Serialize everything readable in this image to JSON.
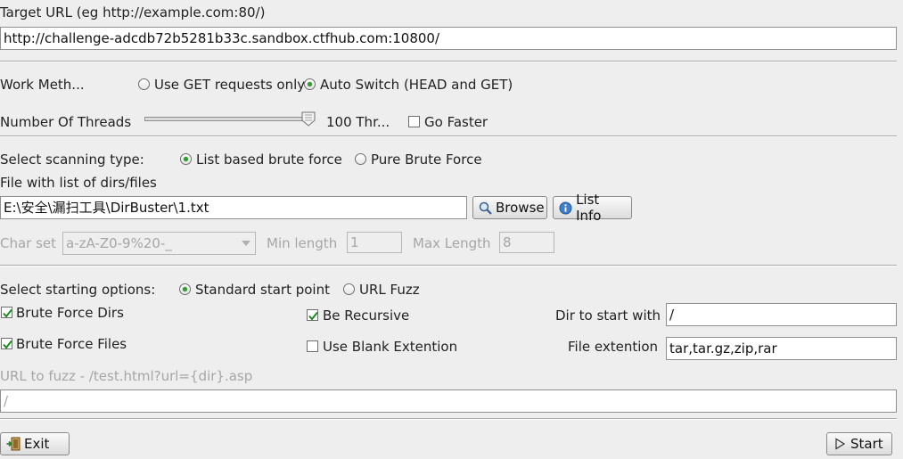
{
  "target": {
    "label": "Target URL (eg http://example.com:80/)",
    "value": "http://challenge-adcdb72b5281b33c.sandbox.ctfhub.com:10800/"
  },
  "work_method": {
    "label": "Work Meth...",
    "options": [
      {
        "label": "Use GET requests only",
        "selected": false
      },
      {
        "label": "Auto Switch (HEAD and GET)",
        "selected": true
      }
    ]
  },
  "threads": {
    "label": "Number Of Threads",
    "value_text": "100 Thr...",
    "slider_fraction": 1.0,
    "go_faster_label": "Go Faster",
    "go_faster_checked": false
  },
  "scanning_type": {
    "label": "Select scanning type:",
    "options": [
      {
        "label": "List based brute force",
        "selected": true
      },
      {
        "label": "Pure Brute Force",
        "selected": false
      }
    ]
  },
  "file_list": {
    "label": "File with list of dirs/files",
    "value": "E:\\安全\\漏扫工具\\DirBuster\\1.txt",
    "browse_label": "Browse",
    "list_info_label": "List Info"
  },
  "charset": {
    "label": "Char set",
    "value": "a-zA-Z0-9%20-_",
    "min_label": "Min length",
    "min_value": "1",
    "max_label": "Max Length",
    "max_value": "8"
  },
  "starting": {
    "label": "Select starting options:",
    "options": [
      {
        "label": "Standard start point",
        "selected": true
      },
      {
        "label": "URL Fuzz",
        "selected": false
      }
    ]
  },
  "options": {
    "brute_dirs": {
      "label": "Brute Force Dirs",
      "checked": true
    },
    "brute_files": {
      "label": "Brute Force Files",
      "checked": true
    },
    "recursive": {
      "label": "Be Recursive",
      "checked": true
    },
    "blank_ext": {
      "label": "Use Blank Extention",
      "checked": false
    },
    "dir_start_label": "Dir to start with",
    "dir_start_value": "/",
    "file_ext_label": "File extention",
    "file_ext_value": "tar,tar.gz,zip,rar"
  },
  "fuzz": {
    "label": "URL to fuzz - /test.html?url={dir}.asp",
    "value": "/"
  },
  "footer": {
    "exit_label": "Exit",
    "start_label": "Start"
  }
}
